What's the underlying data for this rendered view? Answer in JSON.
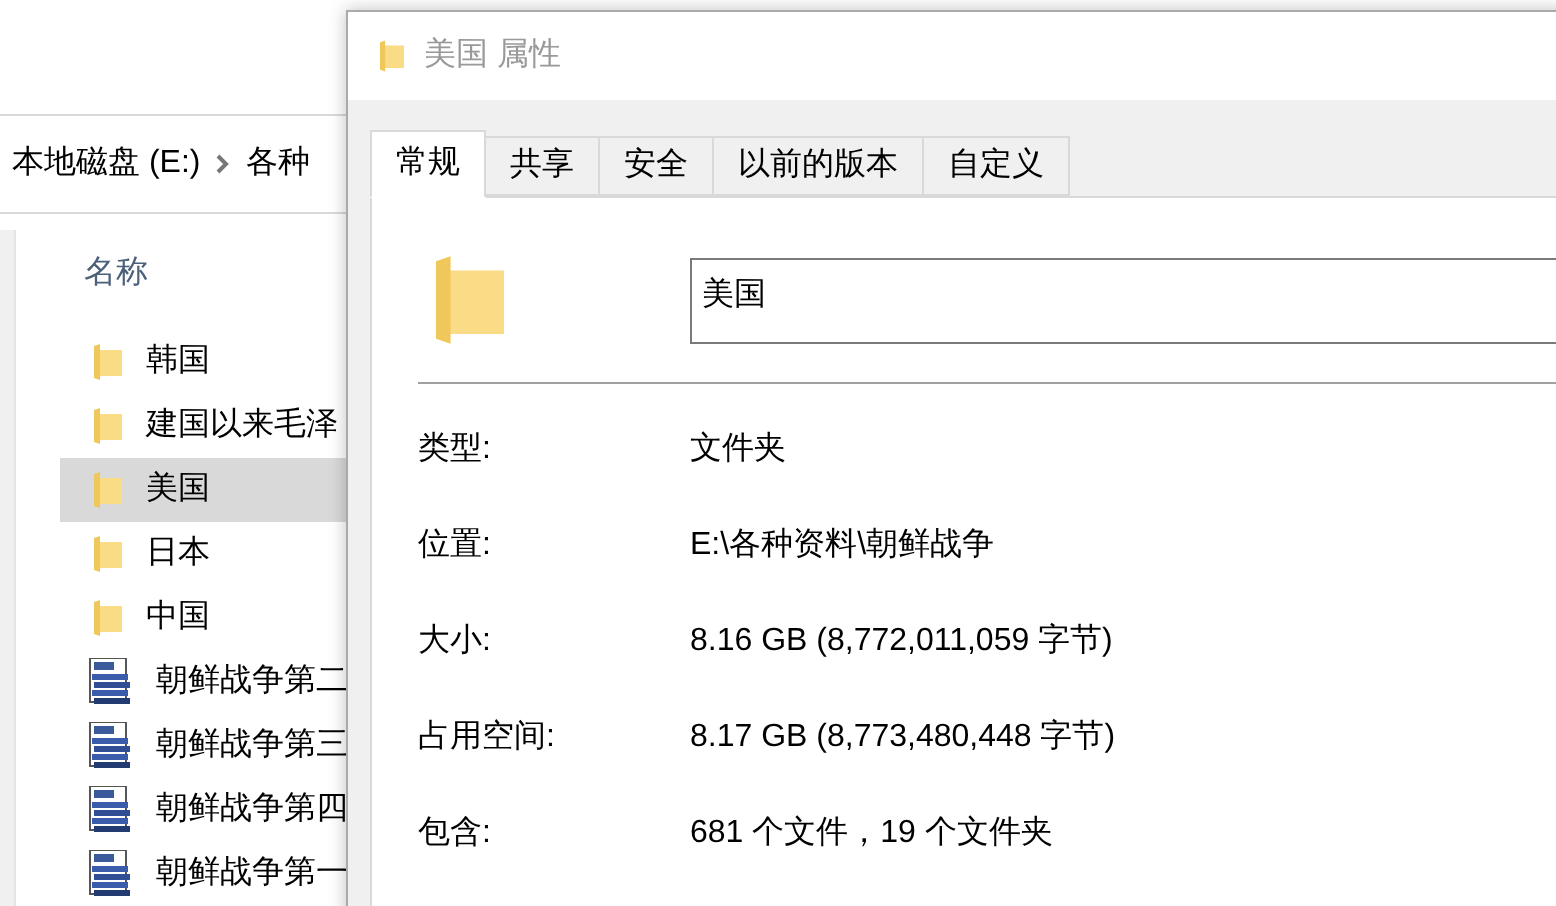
{
  "explorer": {
    "breadcrumb": [
      {
        "label": "本地磁盘 (E:)"
      },
      {
        "label": "各种"
      }
    ],
    "column_header": "名称",
    "files": [
      {
        "name": "韩国",
        "kind": "folder",
        "selected": false
      },
      {
        "name": "建国以来毛泽",
        "kind": "folder",
        "selected": false
      },
      {
        "name": "美国",
        "kind": "folder",
        "selected": true
      },
      {
        "name": "日本",
        "kind": "folder",
        "selected": false
      },
      {
        "name": "中国",
        "kind": "folder",
        "selected": false
      },
      {
        "name": "朝鲜战争第二",
        "kind": "html",
        "selected": false
      },
      {
        "name": "朝鲜战争第三",
        "kind": "html",
        "selected": false
      },
      {
        "name": "朝鲜战争第四",
        "kind": "html",
        "selected": false
      },
      {
        "name": "朝鲜战争第一",
        "kind": "html",
        "selected": false
      }
    ]
  },
  "dialog": {
    "title": "美国 属性",
    "tabs": [
      {
        "label": "常规",
        "selected": true
      },
      {
        "label": "共享",
        "selected": false
      },
      {
        "label": "安全",
        "selected": false
      },
      {
        "label": "以前的版本",
        "selected": false
      },
      {
        "label": "自定义",
        "selected": false
      }
    ],
    "name_value": "美国",
    "properties": [
      {
        "label": "类型:",
        "value": "文件夹"
      },
      {
        "label": "位置:",
        "value": "E:\\各种资料\\朝鲜战争"
      },
      {
        "label": "大小:",
        "value": "8.16 GB (8,772,011,059 字节)"
      },
      {
        "label": "占用空间:",
        "value": "8.17 GB (8,773,480,448 字节)"
      },
      {
        "label": "包含:",
        "value": "681 个文件，19 个文件夹"
      }
    ]
  }
}
